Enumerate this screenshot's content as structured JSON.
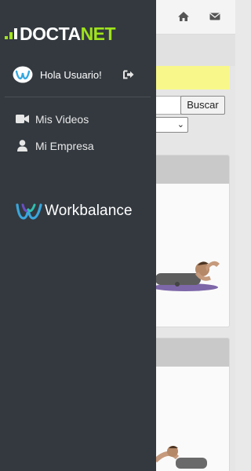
{
  "brand": {
    "logo_text_left": "DOCTA",
    "logo_text_right": "NET",
    "logo_left_color": "#ffffff",
    "logo_right_color": "#9fe31b"
  },
  "user": {
    "greeting": "Hola Usuario!"
  },
  "menu": {
    "items": [
      {
        "label": "Mis Videos",
        "icon": "video-camera-icon"
      },
      {
        "label": "Mi Empresa",
        "icon": "user-icon"
      }
    ]
  },
  "partner": {
    "name": "Workbalance",
    "icon": "workbalance-w-icon"
  },
  "background_page": {
    "search_button_label": "Buscar",
    "header_icons": [
      "home-icon",
      "mail-icon"
    ]
  },
  "colors": {
    "drawer_bg": "#33393f",
    "accent_green": "#9fe31b",
    "highlight_yellow": "#f8f88a"
  }
}
